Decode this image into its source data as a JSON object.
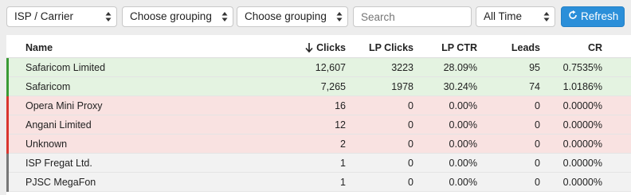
{
  "toolbar": {
    "selects": [
      {
        "label": "ISP / Carrier"
      },
      {
        "label": "Choose grouping"
      },
      {
        "label": "Choose grouping"
      },
      {
        "label": "All Time"
      }
    ],
    "search_placeholder": "Search",
    "refresh_label": "Refresh",
    "accent_color": "#2b8fd9"
  },
  "table": {
    "columns": [
      "Name",
      "Clicks",
      "LP Clicks",
      "LP CTR",
      "Leads",
      "CR"
    ],
    "sorted_column": "Clicks",
    "rows": [
      {
        "name": "Safaricom Limited",
        "clicks": "12,607",
        "lp_clicks": "3223",
        "lp_ctr": "28.09%",
        "leads": "95",
        "cr": "0.7535%",
        "status": "positive"
      },
      {
        "name": "Safaricom",
        "clicks": "7,265",
        "lp_clicks": "1978",
        "lp_ctr": "30.24%",
        "leads": "74",
        "cr": "1.0186%",
        "status": "positive"
      },
      {
        "name": "Opera Mini Proxy",
        "clicks": "16",
        "lp_clicks": "0",
        "lp_ctr": "0.00%",
        "leads": "0",
        "cr": "0.0000%",
        "status": "negative"
      },
      {
        "name": "Angani Limited",
        "clicks": "12",
        "lp_clicks": "0",
        "lp_ctr": "0.00%",
        "leads": "0",
        "cr": "0.0000%",
        "status": "negative"
      },
      {
        "name": "Unknown",
        "clicks": "2",
        "lp_clicks": "0",
        "lp_ctr": "0.00%",
        "leads": "0",
        "cr": "0.0000%",
        "status": "negative"
      },
      {
        "name": "ISP Fregat Ltd.",
        "clicks": "1",
        "lp_clicks": "0",
        "lp_ctr": "0.00%",
        "leads": "0",
        "cr": "0.0000%",
        "status": "neutral"
      },
      {
        "name": "PJSC MegaFon",
        "clicks": "1",
        "lp_clicks": "0",
        "lp_ctr": "0.00%",
        "leads": "0",
        "cr": "0.0000%",
        "status": "neutral"
      }
    ],
    "status_colors": {
      "positive": {
        "bg": "#e4f3e1",
        "bar": "#3b9a36"
      },
      "negative": {
        "bg": "#f9e2e1",
        "bar": "#d9362f"
      },
      "neutral": {
        "bg": "#f2f2f2",
        "bar": "#777777"
      }
    }
  }
}
